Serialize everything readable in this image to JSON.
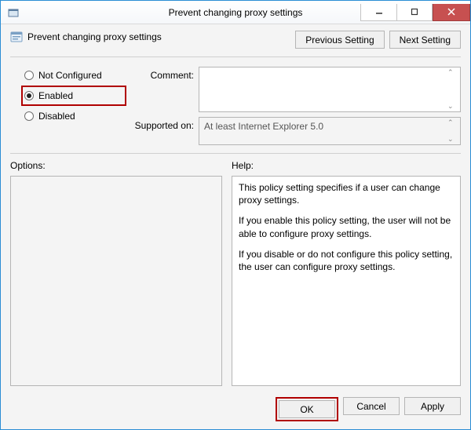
{
  "window": {
    "title": "Prevent changing proxy settings"
  },
  "policy": {
    "title": "Prevent changing proxy settings"
  },
  "nav": {
    "prev": "Previous Setting",
    "next": "Next Setting"
  },
  "state": {
    "not_configured": "Not Configured",
    "enabled": "Enabled",
    "disabled": "Disabled",
    "selected": "enabled"
  },
  "fields": {
    "comment_label": "Comment:",
    "comment_value": "",
    "supported_label": "Supported on:",
    "supported_value": "At least Internet Explorer 5.0"
  },
  "labels": {
    "options": "Options:",
    "help": "Help:"
  },
  "help": {
    "p1": "This policy setting specifies if a user can change proxy settings.",
    "p2": "If you enable this policy setting, the user will not be able to configure proxy settings.",
    "p3": "If you disable or do not configure this policy setting, the user can configure proxy settings."
  },
  "footer": {
    "ok": "OK",
    "cancel": "Cancel",
    "apply": "Apply"
  }
}
